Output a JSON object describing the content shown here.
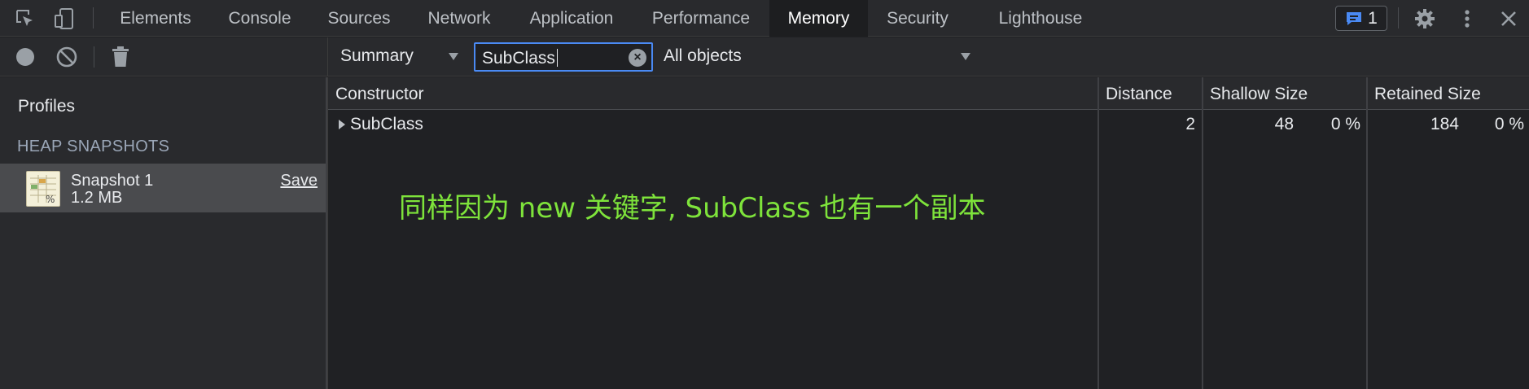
{
  "tabbar": {
    "icons": [
      "inspect-element-icon",
      "device-toolbar-icon"
    ],
    "tabs": [
      {
        "label": "Elements",
        "active": false
      },
      {
        "label": "Console",
        "active": false
      },
      {
        "label": "Sources",
        "active": false
      },
      {
        "label": "Network",
        "active": false
      },
      {
        "label": "Application",
        "active": false
      },
      {
        "label": "Performance",
        "active": false
      },
      {
        "label": "Memory",
        "active": true
      },
      {
        "label": "Security",
        "active": false
      },
      {
        "label": "Lighthouse",
        "active": false
      }
    ],
    "issues_count": "1",
    "right_icons": [
      "issues-icon",
      "gear-icon",
      "more-vert-icon",
      "close-icon"
    ]
  },
  "left_toolbar": {
    "icons": [
      "record-icon",
      "clear-icon",
      "trash-icon"
    ]
  },
  "sidebar": {
    "profiles_title": "Profiles",
    "section_title": "HEAP SNAPSHOTS",
    "snapshot": {
      "name": "Snapshot 1",
      "size": "1.2 MB",
      "save_label": "Save"
    }
  },
  "toolbar": {
    "view_select": "Summary",
    "filter_value": "SubClass",
    "objects_select": "All objects"
  },
  "grid": {
    "headers": {
      "constructor": "Constructor",
      "distance": "Distance",
      "shallow": "Shallow Size",
      "retained": "Retained Size"
    },
    "rows": [
      {
        "constructor": "SubClass",
        "distance": "2",
        "shallow": "48",
        "shallow_pct": "0 %",
        "retained": "184",
        "retained_pct": "0 %"
      }
    ]
  },
  "annotation": "同样因为 new 关键字, SubClass 也有一个副本",
  "colors": {
    "background": "#202124",
    "toolbar": "#292a2d",
    "accent": "#4a8af4",
    "annotation": "#7ee33b",
    "issues_icon": "#4a8af4"
  }
}
